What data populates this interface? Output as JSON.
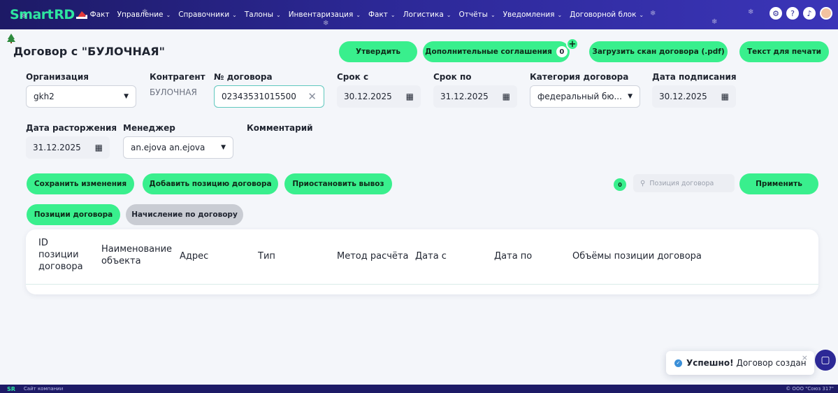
{
  "nav": {
    "logo_smart": "Smart",
    "logo_rd": "RD",
    "items": [
      {
        "label": "Факт",
        "chevron": false
      },
      {
        "label": "Управление",
        "chevron": true
      },
      {
        "label": "Справочники",
        "chevron": true
      },
      {
        "label": "Талоны",
        "chevron": true
      },
      {
        "label": "Инвентаризация",
        "chevron": true
      },
      {
        "label": "Факт",
        "chevron": true
      },
      {
        "label": "Логистика",
        "chevron": true
      },
      {
        "label": "Отчёты",
        "chevron": true
      },
      {
        "label": "Уведомления",
        "chevron": true
      },
      {
        "label": "Договорной блок",
        "chevron": true
      }
    ],
    "right_icons": [
      "settings-icon",
      "help-icon",
      "bell-icon",
      "user-avatar"
    ]
  },
  "header": {
    "title": "Договор с \"БУЛОЧНАЯ\"",
    "approve_label": "Утвердить",
    "agreements_label": "Дополнительные соглашения",
    "agreements_count": "0",
    "add_plus": "+",
    "upload_label": "Загрузить скан договора (.pdf)",
    "print_label": "Текст для печати"
  },
  "form": {
    "organization": {
      "label": "Организация",
      "value": "gkh2"
    },
    "counterparty": {
      "label": "Контрагент",
      "value": "БУЛОЧНАЯ"
    },
    "contract_no": {
      "label": "№ договора",
      "value": "02343531015500"
    },
    "date_from": {
      "label": "Срок с",
      "value": "30.12.2025"
    },
    "date_to": {
      "label": "Срок по",
      "value": "31.12.2025"
    },
    "category": {
      "label": "Категория договора",
      "value": "федеральный бю..."
    },
    "sign_date": {
      "label": "Дата подписания",
      "value": "30.12.2025"
    },
    "termination_date": {
      "label": "Дата расторжения",
      "value": "31.12.2025"
    },
    "manager": {
      "label": "Менеджер",
      "value": "an.ejova an.ejova"
    },
    "comment": {
      "label": "Комментарий"
    }
  },
  "toolbar": {
    "save_label": "Сохранить изменения",
    "add_position_label": "Добавить позицию договора",
    "suspend_label": "Приостановить вывоз",
    "filter_count": "0",
    "search_placeholder": "Позиция договора",
    "apply_label": "Применить"
  },
  "tabs": {
    "positions_label": "Позиции договора",
    "accrual_label": "Начисление по договору"
  },
  "table": {
    "columns": [
      "ID\nпозиции\nдоговора",
      "Наименование\nобъекта",
      "Адрес",
      "Тип",
      "Метод расчёта",
      "Дата с",
      "Дата по",
      "Объёмы позиции договора"
    ]
  },
  "toast": {
    "title": "Успешно!",
    "message": "Договор создан",
    "close": "×"
  },
  "footer": {
    "logo": "SR",
    "link": "Сайт компании",
    "copyright": "© ООО \"Союз 317\""
  },
  "colors": {
    "accent": "#39ef8d",
    "nav_bg": "#2c2896",
    "page_bg": "#f4f6fa"
  }
}
